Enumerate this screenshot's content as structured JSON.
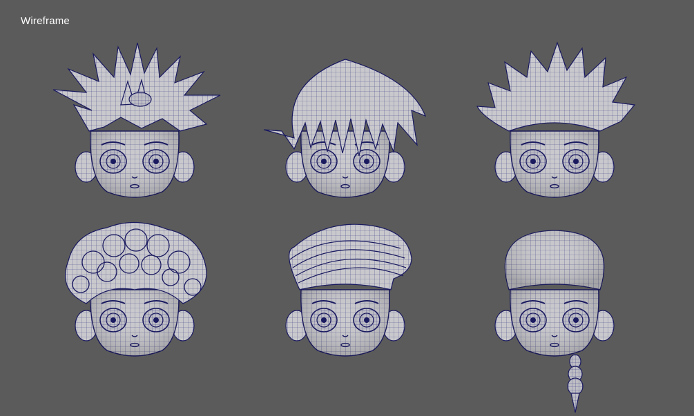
{
  "view": {
    "label": "Wireframe",
    "background": "#5b5b5b",
    "mesh_fill": "#c9c9cd",
    "wire_color": "#22227a"
  },
  "models": [
    {
      "hair": "spiky-tall"
    },
    {
      "hair": "long-bangs"
    },
    {
      "hair": "swept-up-spiky"
    },
    {
      "hair": "curly"
    },
    {
      "hair": "slicked-back"
    },
    {
      "hair": "bald-with-braid"
    }
  ]
}
